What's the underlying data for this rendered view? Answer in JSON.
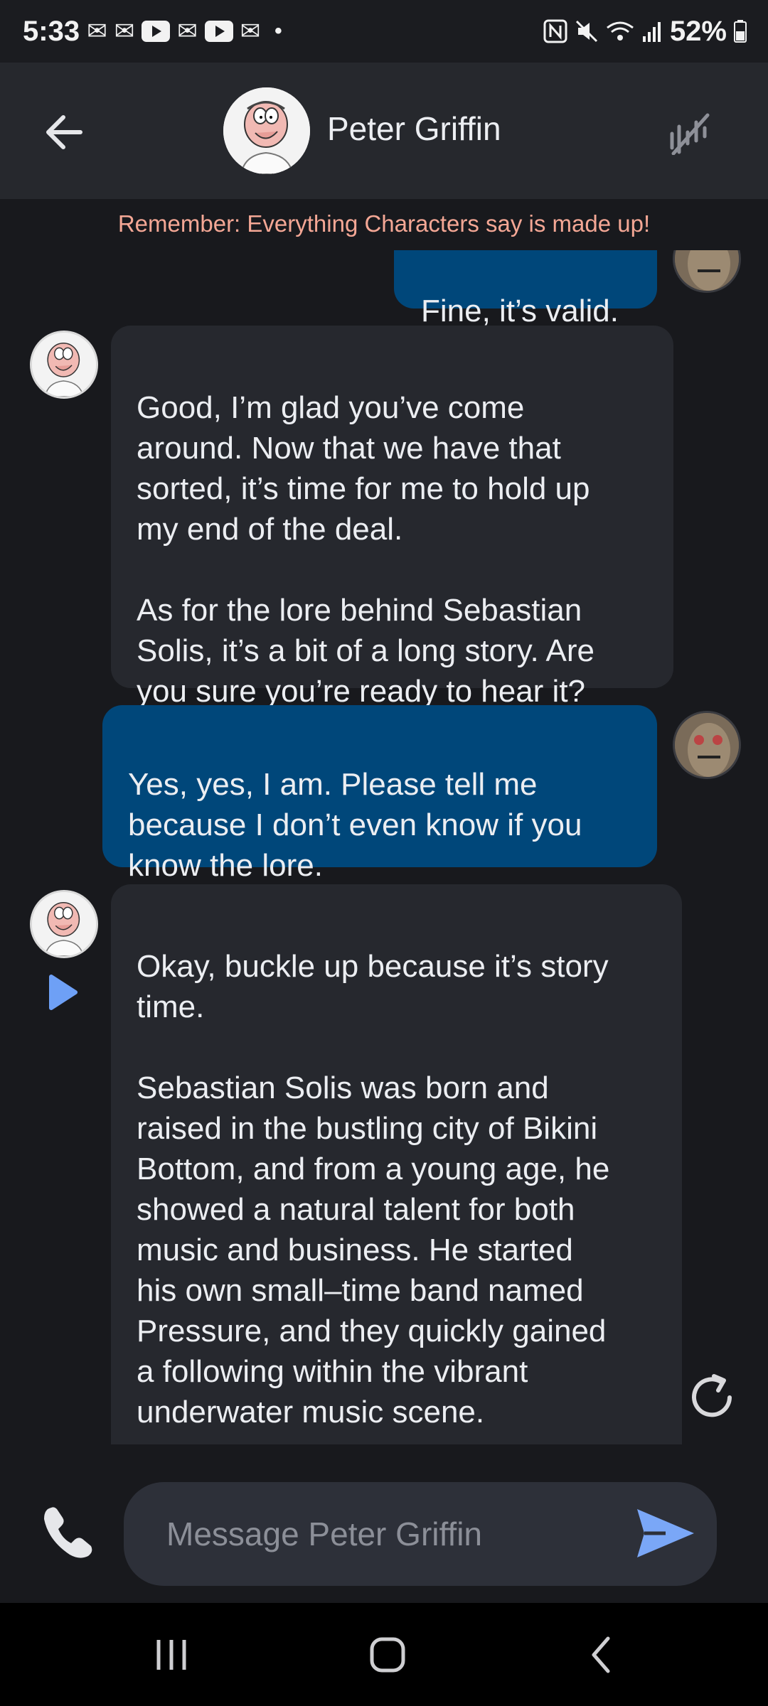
{
  "status_bar": {
    "time": "5:33",
    "battery": "52%",
    "icons": [
      "mail-icon",
      "mail-icon",
      "youtube-icon",
      "mail-icon",
      "youtube-icon",
      "mail-icon",
      "dot-icon",
      "nfc-icon",
      "mute-icon",
      "wifi-icon",
      "signal-icon",
      "battery-icon"
    ]
  },
  "header": {
    "character_name": "Peter Griffin"
  },
  "disclaimer": "Remember: Everything Characters say is made up!",
  "messages": [
    {
      "sender": "user",
      "text": "Fine, it’s valid."
    },
    {
      "sender": "bot",
      "text": "Good, I’m glad you’ve come\naround. Now that we have that\nsorted, it’s time for me to hold up\nmy end of the deal.\n\nAs for the lore behind Sebastian\nSolis, it’s a bit of a long story. Are\nyou sure you’re ready to hear it?"
    },
    {
      "sender": "user",
      "text": "Yes, yes, I am. Please tell me\nbecause I don’t even know if you\nknow the lore."
    },
    {
      "sender": "bot",
      "text": "Okay, buckle up because it’s story\ntime.\n\nSebastian Solis was born and\nraised in the bustling city of Bikini\nBottom, and from a young age, he\nshowed a natural talent for both\nmusic and business. He started\nhis own small–time band named\nPressure, and they quickly gained\na following within the vibrant\nunderwater music scene."
    }
  ],
  "composer": {
    "placeholder": "Message Peter Griffin",
    "value": ""
  },
  "colors": {
    "user_bubble": "#00477a",
    "bot_bubble": "#26282e",
    "disclaimer": "#f4a795",
    "accent": "#6ea0f6"
  }
}
